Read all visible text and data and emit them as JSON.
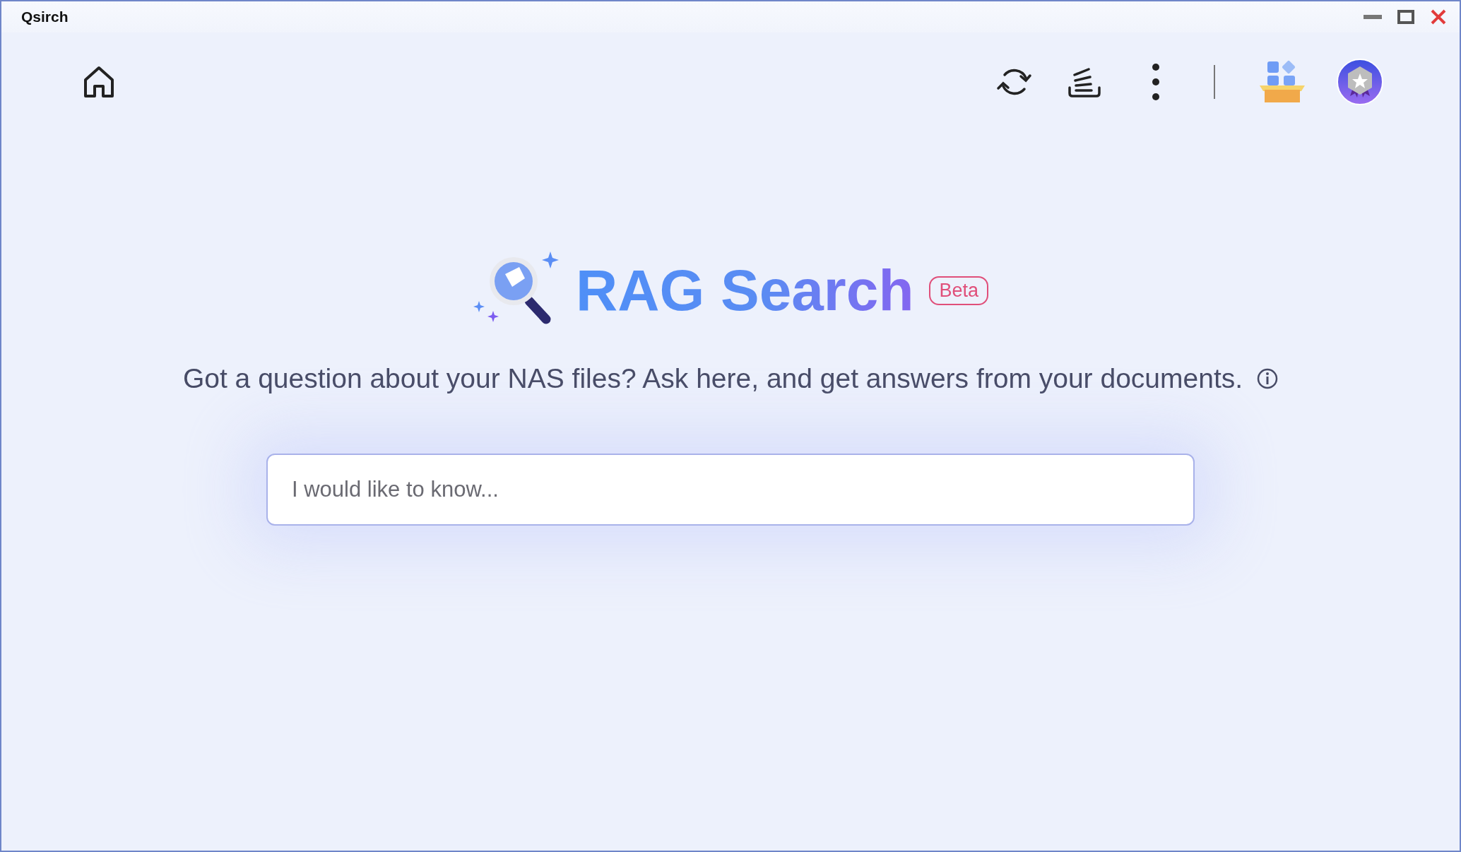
{
  "window": {
    "title": "Qsirch"
  },
  "hero": {
    "title": "RAG Search",
    "badge": "Beta",
    "subtitle": "Got a question about your NAS files? Ask here, and get answers from your documents."
  },
  "search": {
    "placeholder": "I would like to know..."
  }
}
